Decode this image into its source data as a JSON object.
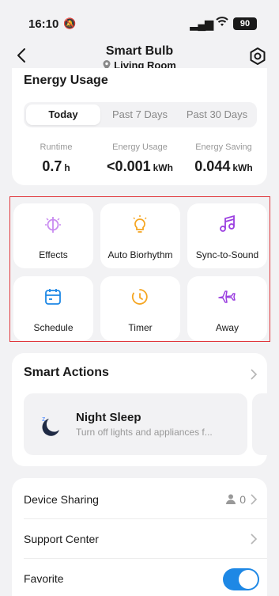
{
  "status_bar": {
    "time": "16:10",
    "battery": "90"
  },
  "header": {
    "title": "Smart Bulb",
    "location": "Living Room"
  },
  "energy": {
    "title": "Energy Usage",
    "tabs": [
      "Today",
      "Past 7 Days",
      "Past 30 Days"
    ],
    "selected_tab": "Today",
    "stats": [
      {
        "label": "Runtime",
        "value": "0.7",
        "unit": "h"
      },
      {
        "label": "Energy Usage",
        "value": "<0.001",
        "unit": "kWh"
      },
      {
        "label": "Energy Saving",
        "value": "0.044",
        "unit": "kWh"
      }
    ]
  },
  "features": [
    {
      "label": "Effects",
      "icon": "effects-icon",
      "color": "#c98bf0"
    },
    {
      "label": "Auto Biorhythm",
      "icon": "bulb-icon",
      "color": "#f5a623"
    },
    {
      "label": "Sync-to-Sound",
      "icon": "music-icon",
      "color": "#9b3fe0"
    },
    {
      "label": "Schedule",
      "icon": "calendar-icon",
      "color": "#1e88e5"
    },
    {
      "label": "Timer",
      "icon": "timer-icon",
      "color": "#f5a623"
    },
    {
      "label": "Away",
      "icon": "plane-icon",
      "color": "#9b3fe0"
    }
  ],
  "smart_actions": {
    "title": "Smart Actions",
    "scene": {
      "name": "Night Sleep",
      "description": "Turn off lights and appliances f..."
    }
  },
  "settings": {
    "device_sharing": {
      "label": "Device Sharing",
      "count": "0"
    },
    "support_center": {
      "label": "Support Center"
    },
    "favorite": {
      "label": "Favorite",
      "on": true
    }
  },
  "colors": {
    "accent": "#1e88e5",
    "highlight_frame": "#e0353b"
  }
}
